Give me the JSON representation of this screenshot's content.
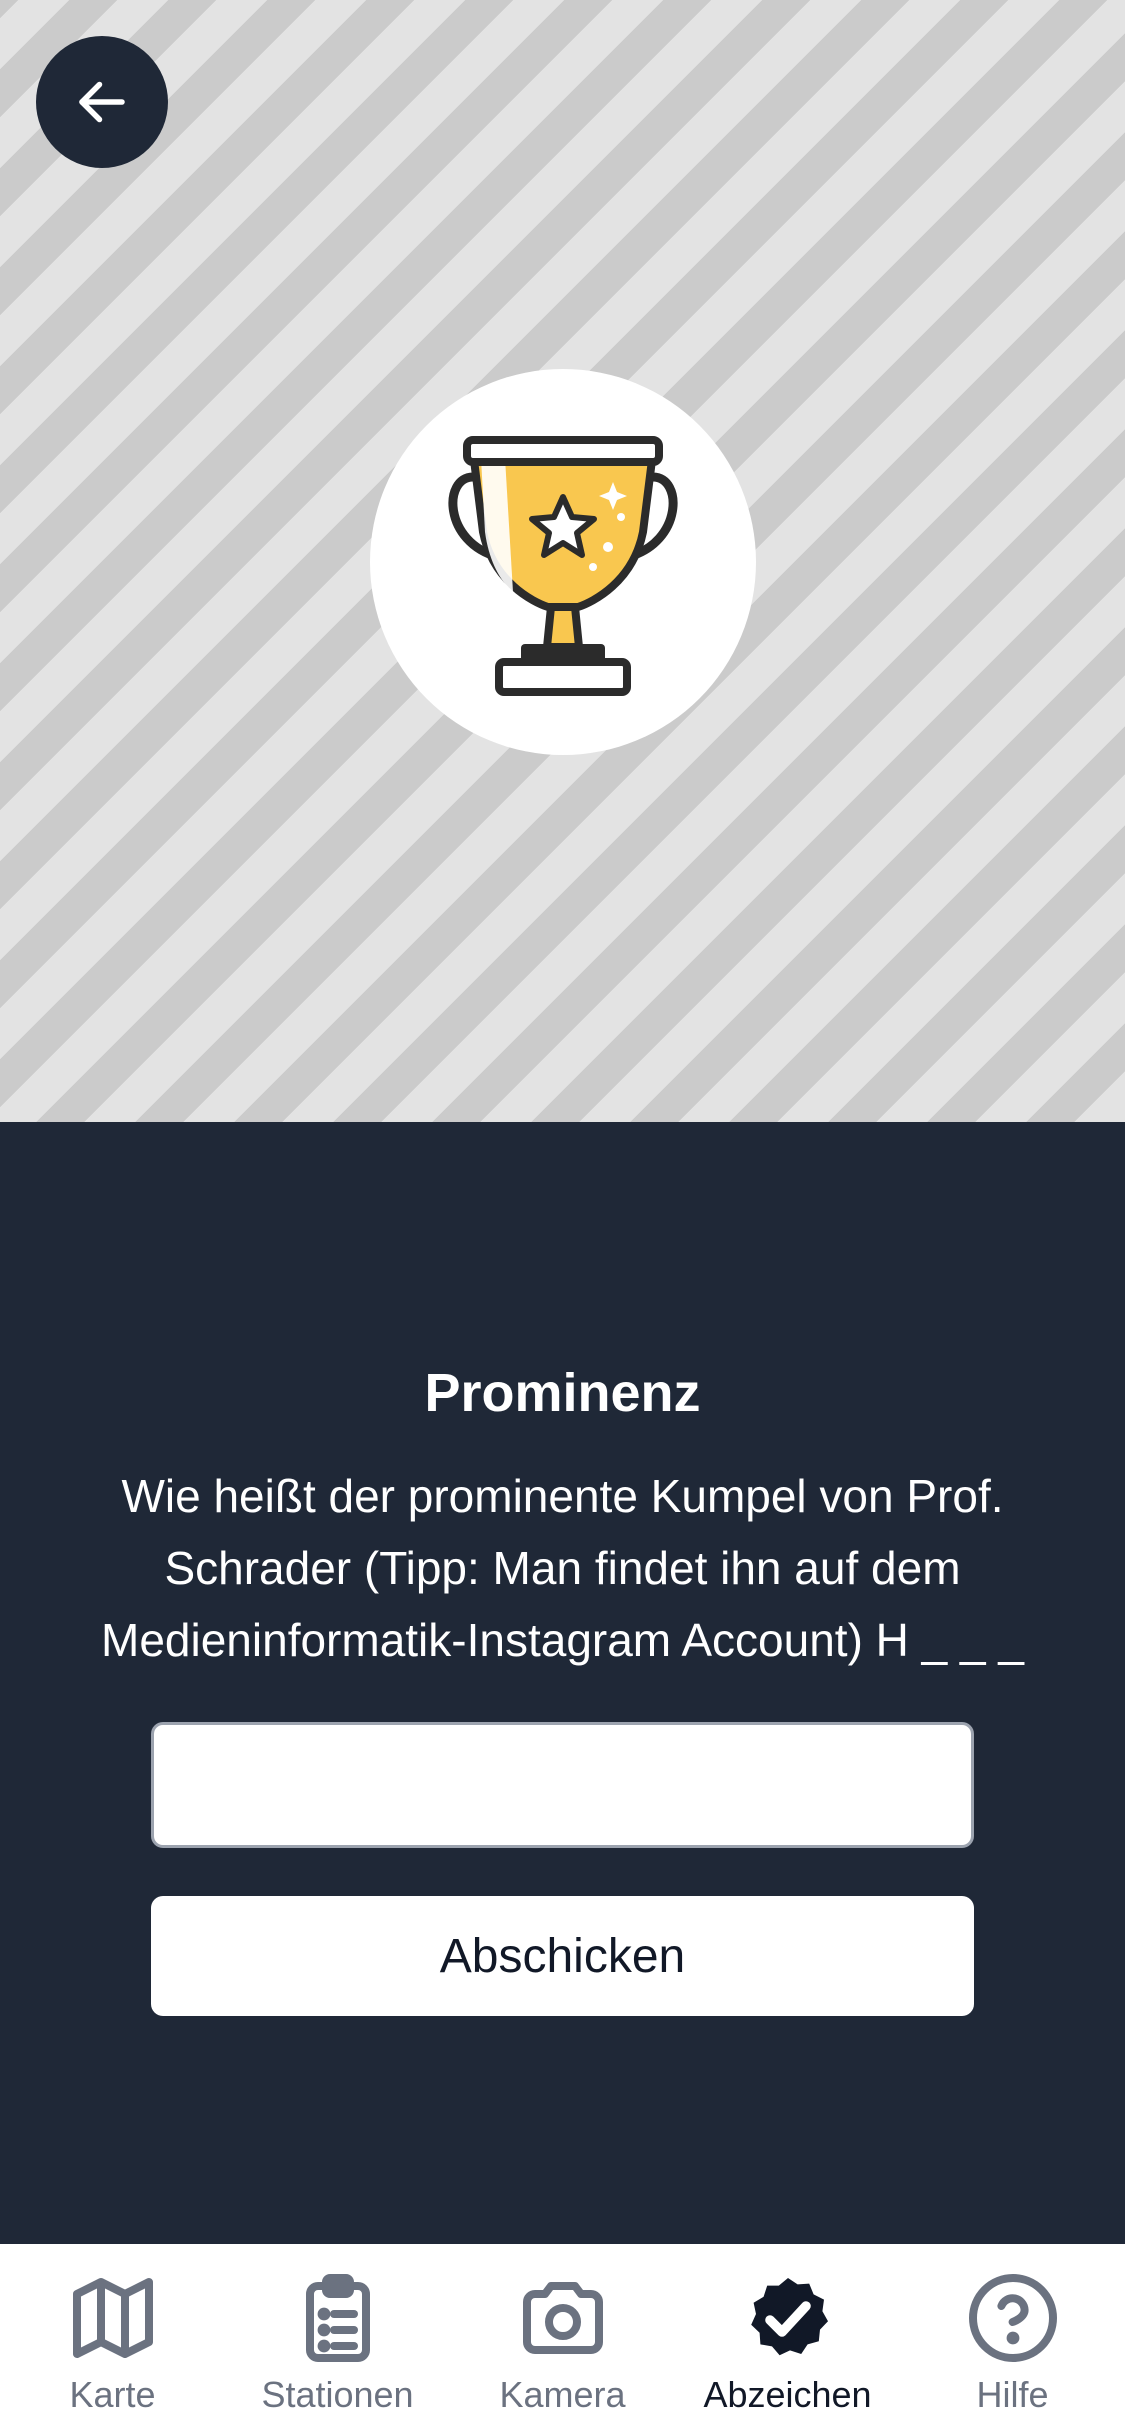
{
  "header": {
    "back_icon": "arrow-left-icon"
  },
  "badge": {
    "icon": "trophy-icon",
    "accent_color": "#f9c74f"
  },
  "challenge": {
    "title": "Prominenz",
    "question": "Wie heißt der prominente Kumpel von Prof. Schrader (Tipp: Man findet ihn auf dem Medieninformatik-Instagram Account) H _ _ _",
    "answer_value": "",
    "submit_label": "Abschicken"
  },
  "tabs": [
    {
      "label": "Karte",
      "icon": "map-icon",
      "active": false
    },
    {
      "label": "Stationen",
      "icon": "clipboard-list-icon",
      "active": false
    },
    {
      "label": "Kamera",
      "icon": "camera-icon",
      "active": false
    },
    {
      "label": "Abzeichen",
      "icon": "badge-check-icon",
      "active": true
    },
    {
      "label": "Hilfe",
      "icon": "help-circle-icon",
      "active": false
    }
  ],
  "colors": {
    "background_dark": "#1f2837",
    "text_light": "#ffffff",
    "tab_inactive": "#6b7280",
    "tab_active": "#111827"
  }
}
